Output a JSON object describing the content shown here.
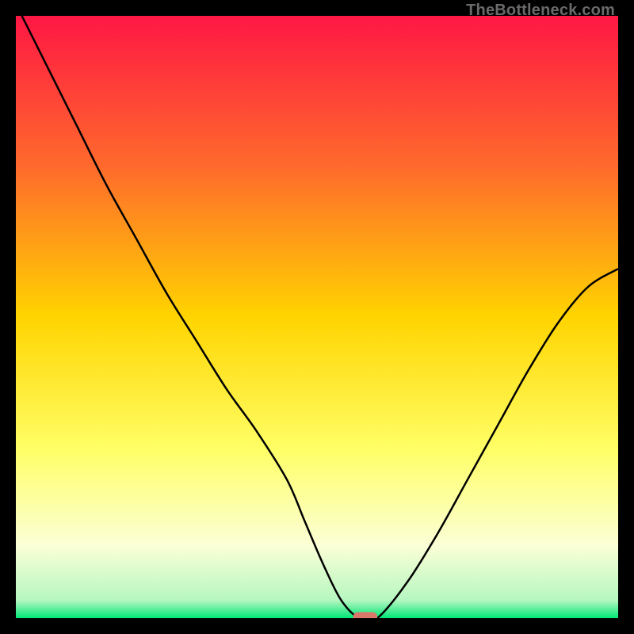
{
  "watermark": "TheBottleneck.com",
  "chart_data": {
    "type": "line",
    "title": "",
    "xlabel": "",
    "ylabel": "",
    "xlim": [
      0,
      100
    ],
    "ylim": [
      0,
      100
    ],
    "grid": false,
    "legend": false,
    "gradient_bg": {
      "stops": [
        {
          "offset": 0.0,
          "color": "#ff1744"
        },
        {
          "offset": 0.25,
          "color": "#ff6a2c"
        },
        {
          "offset": 0.5,
          "color": "#ffd400"
        },
        {
          "offset": 0.72,
          "color": "#ffff66"
        },
        {
          "offset": 0.88,
          "color": "#fbffd6"
        },
        {
          "offset": 0.97,
          "color": "#b6f7c1"
        },
        {
          "offset": 1.0,
          "color": "#00e676"
        }
      ]
    },
    "series": [
      {
        "name": "bottleneck-curve",
        "type": "line",
        "color": "#000000",
        "x": [
          1,
          5,
          10,
          15,
          20,
          25,
          30,
          35,
          40,
          45,
          48,
          51,
          54,
          57,
          60,
          65,
          70,
          75,
          80,
          85,
          90,
          95,
          100
        ],
        "y": [
          100,
          92,
          82,
          72,
          63,
          54,
          46,
          38,
          31,
          23,
          16,
          9,
          3,
          0,
          0,
          6,
          14,
          23,
          32,
          41,
          49,
          55,
          58
        ]
      },
      {
        "name": "optimal-marker",
        "type": "marker",
        "shape": "rounded-rect",
        "color": "#d9786a",
        "x": 58,
        "y": 0,
        "width_x_units": 4,
        "height_y_units": 2
      }
    ]
  }
}
